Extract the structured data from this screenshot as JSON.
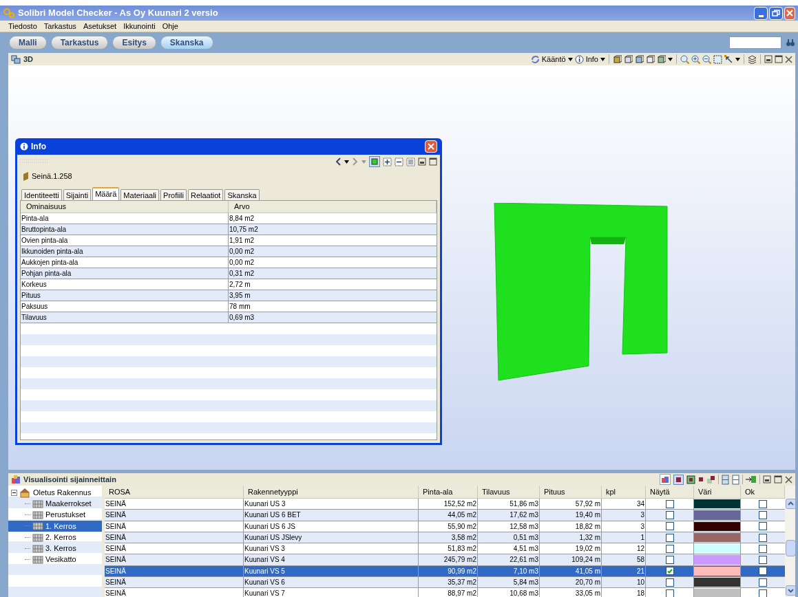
{
  "window": {
    "title": "Solibri Model Checker - As Oy Kuunari 2 versio"
  },
  "menu": [
    "Tiedosto",
    "Tarkastus",
    "Asetukset",
    "Ikkunointi",
    "Ohje"
  ],
  "nav_tabs": [
    {
      "label": "Malli",
      "selected": false
    },
    {
      "label": "Tarkastus",
      "selected": false
    },
    {
      "label": "Esitys",
      "selected": false
    },
    {
      "label": "Skanska",
      "selected": true
    }
  ],
  "view_panel": {
    "title": "3D",
    "toolbar": [
      "Kääntö",
      "Info"
    ]
  },
  "info_dialog": {
    "title": "Info",
    "object": "Seinä.1.258",
    "tabs": [
      {
        "label": "Identiteetti",
        "selected": false
      },
      {
        "label": "Sijainti",
        "selected": false
      },
      {
        "label": "Määrä",
        "selected": true
      },
      {
        "label": "Materiaali",
        "selected": false
      },
      {
        "label": "Profiili",
        "selected": false
      },
      {
        "label": "Relaatiot",
        "selected": false
      },
      {
        "label": "Skanska",
        "selected": false
      }
    ],
    "columns": [
      "Ominaisuus",
      "Arvo"
    ],
    "rows": [
      [
        "Pinta-ala",
        "8,84 m2"
      ],
      [
        "Bruttopinta-ala",
        "10,75 m2"
      ],
      [
        "Ovien pinta-ala",
        "1,91 m2"
      ],
      [
        "Ikkunoiden pinta-ala",
        "0,00 m2"
      ],
      [
        "Aukkojen pinta-ala",
        "0,00 m2"
      ],
      [
        "Pohjan pinta-ala",
        "0,31 m2"
      ],
      [
        "Korkeus",
        "2,72 m"
      ],
      [
        "Pituus",
        "3,95 m"
      ],
      [
        "Paksuus",
        "78 mm"
      ],
      [
        "Tilavuus",
        "0,69 m3"
      ]
    ]
  },
  "bottom_panel": {
    "title": "Visualisointi sijainneittain",
    "tree": [
      {
        "label": "Oletus Rakennus",
        "expanded": true,
        "selected": false,
        "children": [
          {
            "label": "Maakerrokset",
            "selected": false
          },
          {
            "label": "Perustukset",
            "selected": false
          },
          {
            "label": "1. Kerros",
            "selected": true
          },
          {
            "label": "2. Kerros",
            "selected": false
          },
          {
            "label": "3. Kerros",
            "selected": false
          },
          {
            "label": "Vesikatto",
            "selected": false
          }
        ]
      }
    ],
    "columns": [
      "ROSA",
      "Rakennetyyppi",
      "Pinta-ala",
      "Tilavuus",
      "Pituus",
      "kpl",
      "Näytä",
      "Väri",
      "Ok"
    ],
    "rows": [
      {
        "rosa": "SEINÄ",
        "type": "Kuunari US 3",
        "area": "152,52 m2",
        "volume": "51,86 m3",
        "length": "57,92 m",
        "count": "34",
        "show": false,
        "color": "#003333",
        "ok": false,
        "selected": false
      },
      {
        "rosa": "SEINÄ",
        "type": "Kuunari US 6 BET",
        "area": "44,05 m2",
        "volume": "17,62 m3",
        "length": "19,40 m",
        "count": "3",
        "show": false,
        "color": "#666699",
        "ok": false,
        "selected": false
      },
      {
        "rosa": "SEINÄ",
        "type": "Kuunari US 6 JS",
        "area": "55,90 m2",
        "volume": "12,58 m3",
        "length": "18,82 m",
        "count": "3",
        "show": false,
        "color": "#330000",
        "ok": false,
        "selected": false
      },
      {
        "rosa": "SEINÄ",
        "type": "Kuunari US JSlevy",
        "area": "3,58 m2",
        "volume": "0,51 m3",
        "length": "1,32 m",
        "count": "1",
        "show": false,
        "color": "#996666",
        "ok": false,
        "selected": false
      },
      {
        "rosa": "SEINÄ",
        "type": "Kuunari VS 3",
        "area": "51,83 m2",
        "volume": "4,51 m3",
        "length": "19,02 m",
        "count": "12",
        "show": false,
        "color": "#ccffff",
        "ok": false,
        "selected": false
      },
      {
        "rosa": "SEINÄ",
        "type": "Kuunari VS 4",
        "area": "245,79 m2",
        "volume": "22,61 m3",
        "length": "109,24 m",
        "count": "58",
        "show": false,
        "color": "#cc99ff",
        "ok": false,
        "selected": false
      },
      {
        "rosa": "SEINÄ",
        "type": "Kuunari VS 5",
        "area": "90,99 m2",
        "volume": "7,10 m3",
        "length": "41,05 m",
        "count": "21",
        "show": true,
        "color": "#ffbbbb",
        "ok": false,
        "selected": true
      },
      {
        "rosa": "SEINÄ",
        "type": "Kuunari VS 6",
        "area": "35,37 m2",
        "volume": "5,84 m3",
        "length": "20,70 m",
        "count": "10",
        "show": false,
        "color": "#333333",
        "ok": false,
        "selected": false
      },
      {
        "rosa": "SEINÄ",
        "type": "Kuunari VS 7",
        "area": "88,97 m2",
        "volume": "10,68 m3",
        "length": "33,05 m",
        "count": "18",
        "show": false,
        "color": "#c0c0c0",
        "ok": false,
        "selected": false
      }
    ]
  }
}
